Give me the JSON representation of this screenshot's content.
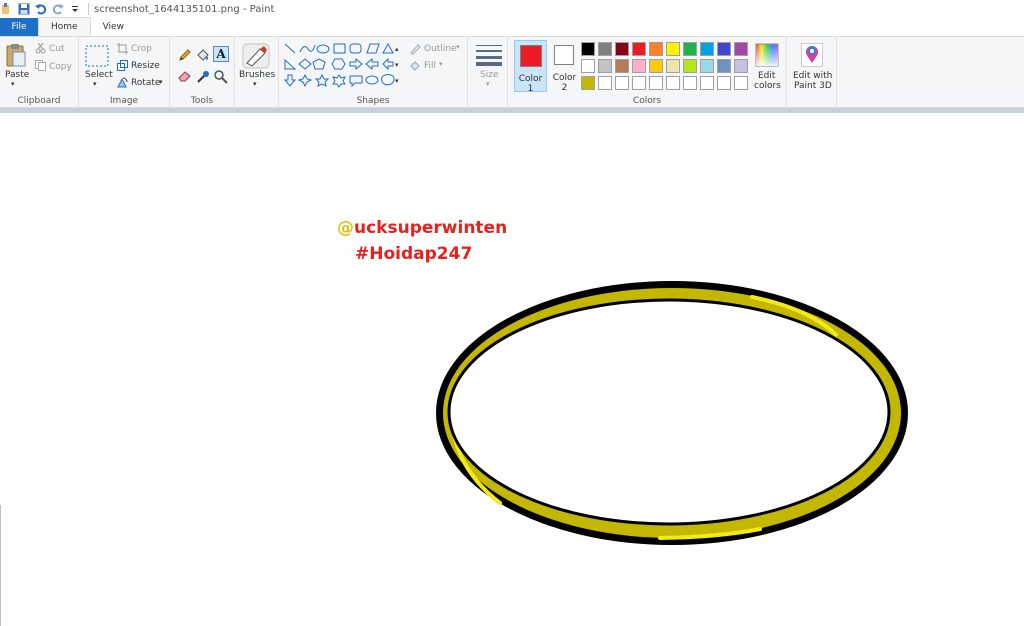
{
  "window": {
    "title": "screenshot_1644135101.png - Paint"
  },
  "tabs": [
    {
      "label": "File"
    },
    {
      "label": "Home"
    },
    {
      "label": "View"
    }
  ],
  "clipboard": {
    "paste": "Paste",
    "cut": "Cut",
    "copy": "Copy",
    "group": "Clipboard"
  },
  "image": {
    "select": "Select",
    "crop": "Crop",
    "resize": "Resize",
    "rotate": "Rotate",
    "group": "Image"
  },
  "tools": {
    "group": "Tools"
  },
  "brushes": {
    "label": "Brushes"
  },
  "shapes": {
    "outline": "Outline",
    "fill": "Fill",
    "group": "Shapes"
  },
  "size": {
    "label": "Size"
  },
  "colors": {
    "color1": "Color",
    "color1_num": "1",
    "color2": "Color",
    "color2_num": "2",
    "edit_colors_line1": "Edit",
    "edit_colors_line2": "colors",
    "group": "Colors",
    "color1_value": "#ed1c24",
    "color2_value": "#ffffff",
    "palette_row1": [
      "#000000",
      "#7f7f7f",
      "#880015",
      "#ed1c24",
      "#ff7f27",
      "#fff200",
      "#22b14c",
      "#00a2e8",
      "#3f48cc",
      "#a349a4"
    ],
    "palette_row2": [
      "#ffffff",
      "#c3c3c3",
      "#b97a57",
      "#ffaec9",
      "#ffc90e",
      "#efe4b0",
      "#b5e61d",
      "#99d9ea",
      "#7092be",
      "#c8bfe7"
    ],
    "palette_row3": [
      "#c3b700",
      "#ffffff",
      "#ffffff",
      "#ffffff",
      "#ffffff",
      "#ffffff",
      "#ffffff",
      "#ffffff",
      "#ffffff",
      "#ffffff"
    ]
  },
  "paint3d": {
    "line1": "Edit with",
    "line2": "Paint 3D"
  },
  "canvas": {
    "watermark_at": "@",
    "watermark_user": "ucksuperwinten",
    "watermark_tag": "#Hoidap247",
    "ring_fill": "#c3b700",
    "ring_highlight": "#f2ea14",
    "ring_outline": "#000000"
  }
}
